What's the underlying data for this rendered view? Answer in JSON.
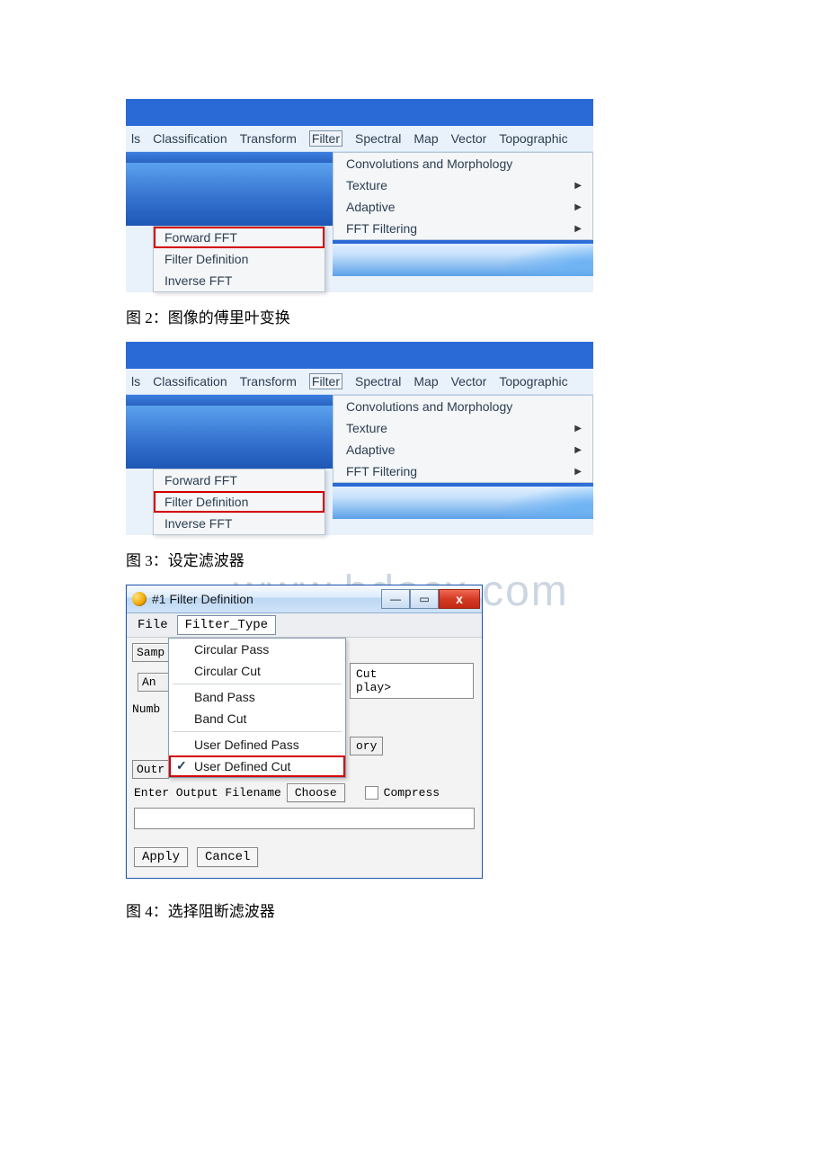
{
  "fig2": {
    "caption": "图 2：图像的傅里叶变换",
    "menubar": {
      "left_fragment": "ls",
      "items": [
        "Classification",
        "Transform",
        "Filter",
        "Spectral",
        "Map",
        "Vector",
        "Topographic"
      ]
    },
    "dropdown": {
      "items": [
        {
          "label": "Convolutions and Morphology",
          "has_sub": false
        },
        {
          "label": "Texture",
          "has_sub": true
        },
        {
          "label": "Adaptive",
          "has_sub": true
        },
        {
          "label": "FFT Filtering",
          "has_sub": true
        }
      ]
    },
    "fft_submenu": {
      "items": [
        {
          "label": "Forward FFT",
          "highlighted": true
        },
        {
          "label": "Filter Definition",
          "highlighted": false
        },
        {
          "label": "Inverse FFT",
          "highlighted": false
        }
      ]
    }
  },
  "fig3": {
    "caption": "图 3：设定滤波器",
    "menubar": {
      "left_fragment": "ls",
      "items": [
        "Classification",
        "Transform",
        "Filter",
        "Spectral",
        "Map",
        "Vector",
        "Topographic"
      ]
    },
    "dropdown": {
      "items": [
        {
          "label": "Convolutions and Morphology",
          "has_sub": false
        },
        {
          "label": "Texture",
          "has_sub": true
        },
        {
          "label": "Adaptive",
          "has_sub": true
        },
        {
          "label": "FFT Filtering",
          "has_sub": true
        }
      ]
    },
    "fft_submenu": {
      "items": [
        {
          "label": "Forward FFT",
          "highlighted": false
        },
        {
          "label": "Filter Definition",
          "highlighted": true
        },
        {
          "label": "Inverse FFT",
          "highlighted": false
        }
      ]
    }
  },
  "watermark_text": "www.bdocx.com",
  "dialog": {
    "title": "#1 Filter Definition",
    "menubar": {
      "file": "File",
      "filter_type": "Filter_Type"
    },
    "left_labels": {
      "samp": "Samp",
      "an": "An",
      "numb": "Numb",
      "outr": "Outr"
    },
    "filter_type_menu": {
      "items": [
        {
          "label": "Circular Pass",
          "checked": false
        },
        {
          "label": "Circular Cut",
          "checked": false
        },
        {
          "sep": true
        },
        {
          "label": "Band Pass",
          "checked": false
        },
        {
          "label": "Band Cut",
          "checked": false
        },
        {
          "sep": true
        },
        {
          "label": "User Defined Pass",
          "checked": false
        },
        {
          "label": "User Defined Cut",
          "checked": true,
          "highlighted": true
        }
      ]
    },
    "right_fragments": {
      "cut": "Cut",
      "play": "play>",
      "ory": "ory"
    },
    "enter_output_label": "Enter Output Filename",
    "choose_button": "Choose",
    "compress_label": "Compress",
    "apply_button": "Apply",
    "cancel_button": "Cancel"
  },
  "fig4_caption": "图 4：选择阻断滤波器"
}
